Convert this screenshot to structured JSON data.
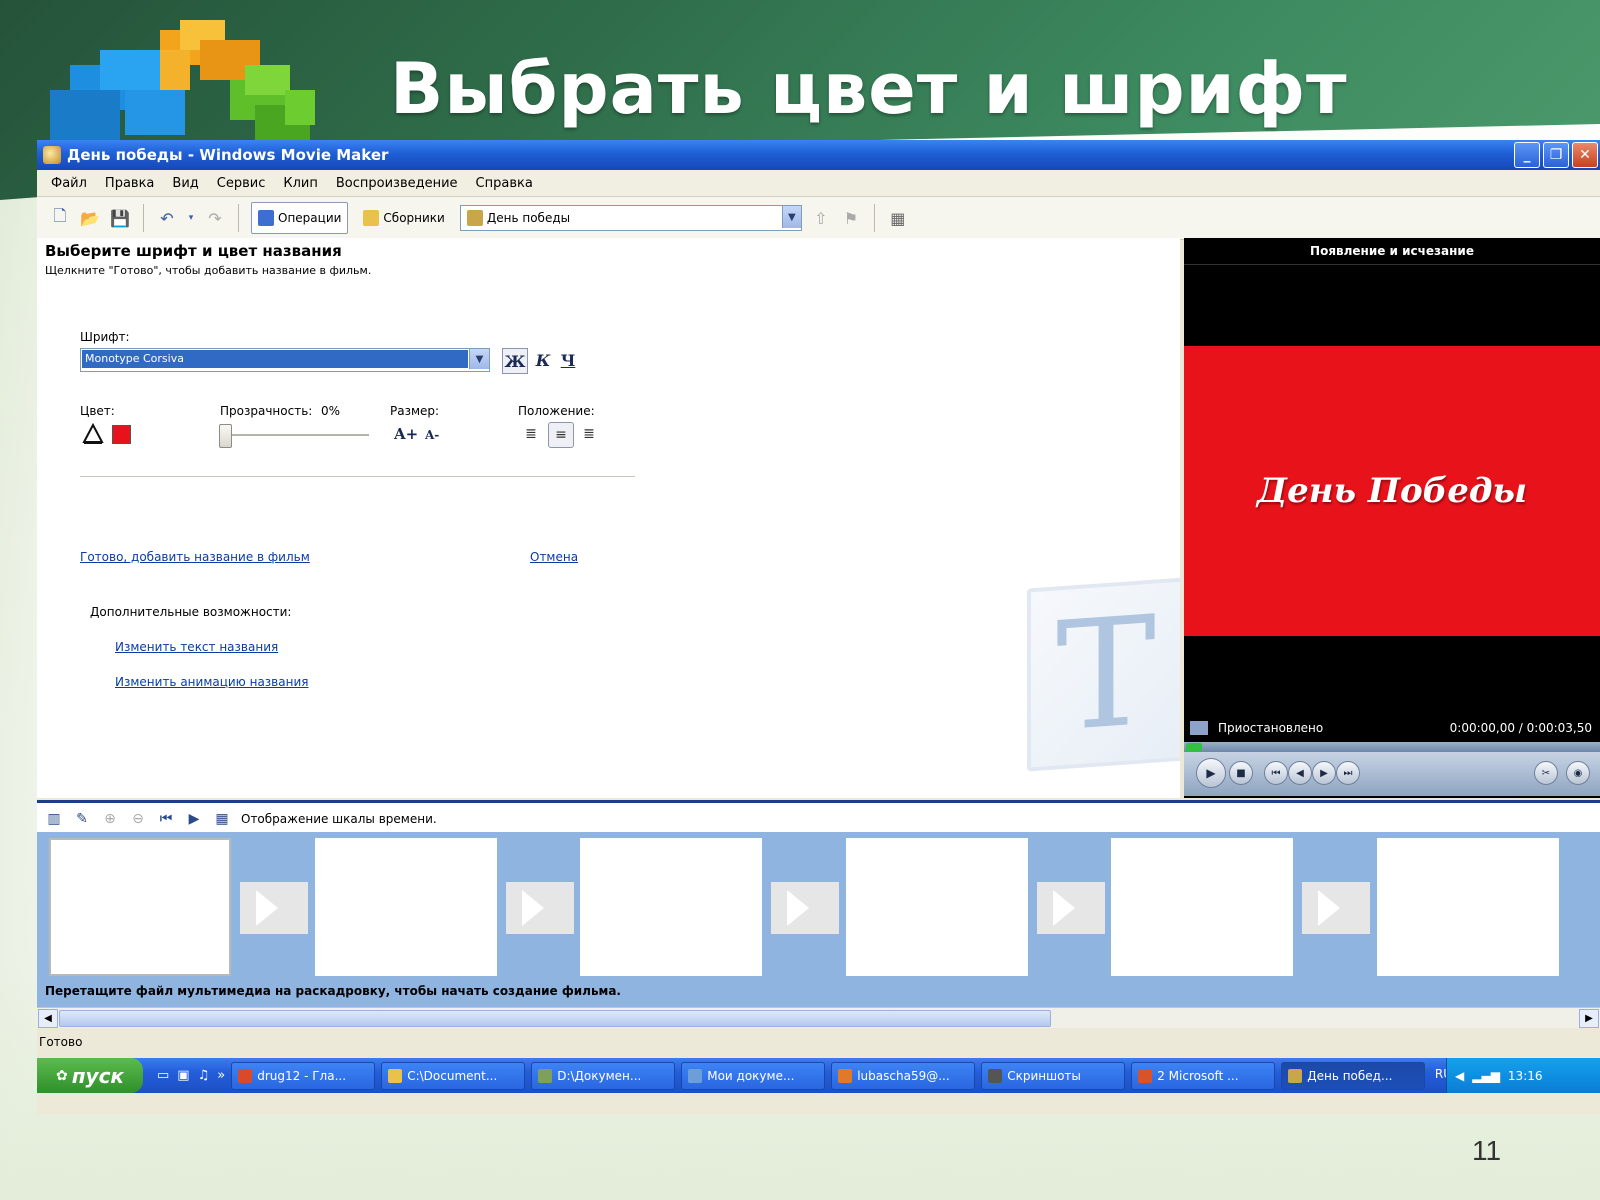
{
  "slide": {
    "title": "Выбрать цвет и шрифт",
    "page_number": "11"
  },
  "window": {
    "title": "День победы - Windows Movie Maker",
    "controls": [
      "_",
      "❐",
      "✕"
    ]
  },
  "menu": [
    "Файл",
    "Правка",
    "Вид",
    "Сервис",
    "Клип",
    "Воспроизведение",
    "Справка"
  ],
  "toolbar": {
    "operations_label": "Операции",
    "collections_label": "Сборники",
    "collection_value": "День победы"
  },
  "task_pane": {
    "heading": "Выберите шрифт и цвет названия",
    "subheading": "Щелкните \"Готово\", чтобы добавить название в фильм.",
    "font_label": "Шрифт:",
    "font_value": "Monotype Corsiva",
    "style_bold": "Ж",
    "style_italic": "К",
    "style_underline": "Ч",
    "color_label": "Цвет:",
    "text_color": "#e8121b",
    "transparency_label": "Прозрачность:",
    "transparency_value": "0%",
    "size_label": "Размер:",
    "size_increase": "A+",
    "size_decrease": "A-",
    "position_label": "Положение:",
    "done_link": "Готово, добавить название в фильм",
    "cancel_link": "Отмена",
    "more_options_label": "Дополнительные возможности:",
    "edit_text_link": "Изменить текст названия",
    "edit_animation_link": "Изменить анимацию названия"
  },
  "preview": {
    "title": "Появление и исчезание",
    "title_text": "День Победы",
    "background_color": "#e8121b",
    "status": "Приостановлено",
    "time": "0:00:00,00 / 0:00:03,50"
  },
  "storyboard": {
    "toolbar_label": "Отображение шкалы времени.",
    "hint": "Перетащите файл мультимедиа на раскадровку, чтобы начать создание фильма.",
    "frames": 6
  },
  "status_bar": "Готово",
  "taskbar": {
    "start": "пуск",
    "tasks": [
      {
        "label": "drug12 - Гла...",
        "color": "#d94a2a"
      },
      {
        "label": "C:\\Document...",
        "color": "#e8c24a"
      },
      {
        "label": "D:\\Докумен...",
        "color": "#7fa05a"
      },
      {
        "label": "Мои докуме...",
        "color": "#6c9fd8"
      },
      {
        "label": "lubascha59@...",
        "color": "#e07a2a"
      },
      {
        "label": "Скриншоты",
        "color": "#555555"
      },
      {
        "label": "2 Microsoft ...",
        "color": "#d9532a"
      },
      {
        "label": "День побед...",
        "color": "#c9a64a"
      }
    ],
    "lang": "RU",
    "clock": "13:16"
  }
}
